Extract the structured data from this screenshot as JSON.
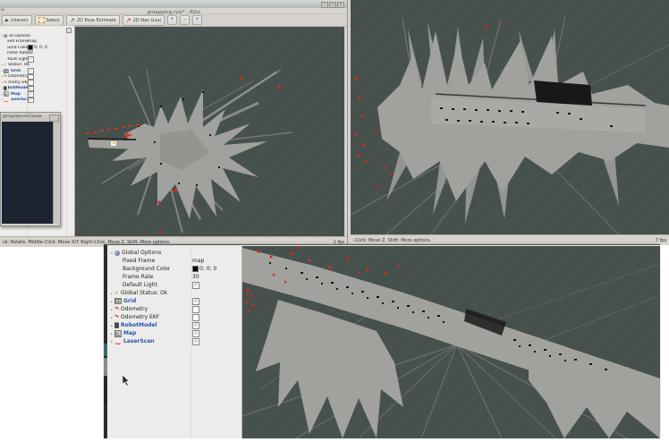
{
  "colors": {
    "viewport_bg": "#47514d",
    "map_gray": "#a1a19d",
    "laser_red": "#dd2f1c",
    "display_enabled_blue": "#2456a8",
    "panel_bg": "#edecea",
    "window_chrome": "#d6d3ce",
    "console_bg": "#1c2432"
  },
  "rviz_main": {
    "title": "gmapping.rviz* - RViz",
    "window_buttons": [
      "–",
      "□",
      "✕"
    ],
    "menu_fragment": "lp",
    "toolbar": [
      {
        "label": "Interact",
        "icon": "interact-cursor"
      },
      {
        "label": "Select",
        "icon": "select-box"
      },
      {
        "label": "2D Pose Estimate",
        "icon": "green-arrow",
        "glyph": "↗"
      },
      {
        "label": "2D Nav Goal",
        "icon": "red-arrow",
        "glyph": "↗"
      }
    ],
    "toolbar_extra": [
      "+",
      "−",
      "+"
    ],
    "status_hint": "ck: Rotate.  Middle-Click: Move X/Y.  Right-Click: Move Z.  Shift: More options.",
    "fps": "1 fps"
  },
  "rviz_right": {
    "status_hint": "-Click: Move Z.  Shift: More options.",
    "fps": "7 fps"
  },
  "console_window": {
    "title": "gmapOpenAiGazeb"
  },
  "displays_panel": {
    "check_glyph": "✓",
    "icon_glyphs": {
      "status-ok": "✓",
      "odometry": "↷"
    },
    "rows": [
      {
        "label": "Global Options",
        "icon": "globe",
        "expander": "▾"
      },
      {
        "label": "Fixed Frame",
        "value": "map",
        "indent": 1
      },
      {
        "label": "Background Color",
        "value": "0; 0; 0",
        "swatch": "#000000",
        "indent": 1
      },
      {
        "label": "Frame Rate",
        "value": "30",
        "indent": 1
      },
      {
        "label": "Default Light",
        "check": true,
        "indent": 1
      },
      {
        "label": "Global Status: Ok",
        "icon": "status-ok",
        "expander": "▸"
      },
      {
        "label": "Grid",
        "icon": "grid",
        "expander": "▸",
        "blue": true,
        "check": true
      },
      {
        "label": "Odometry",
        "icon": "odometry",
        "expander": "▸",
        "check": false
      },
      {
        "label": "Odometry EKF",
        "icon": "odometry",
        "expander": "▸",
        "check": false
      },
      {
        "label": "RobotModel",
        "icon": "robot",
        "expander": "▸",
        "blue": true,
        "check": true
      },
      {
        "label": "Map",
        "icon": "map",
        "expander": "▸",
        "blue": true,
        "check": true
      },
      {
        "label": "LaserScan",
        "icon": "laser",
        "expander": "▸",
        "blue": true,
        "check": true
      }
    ]
  }
}
